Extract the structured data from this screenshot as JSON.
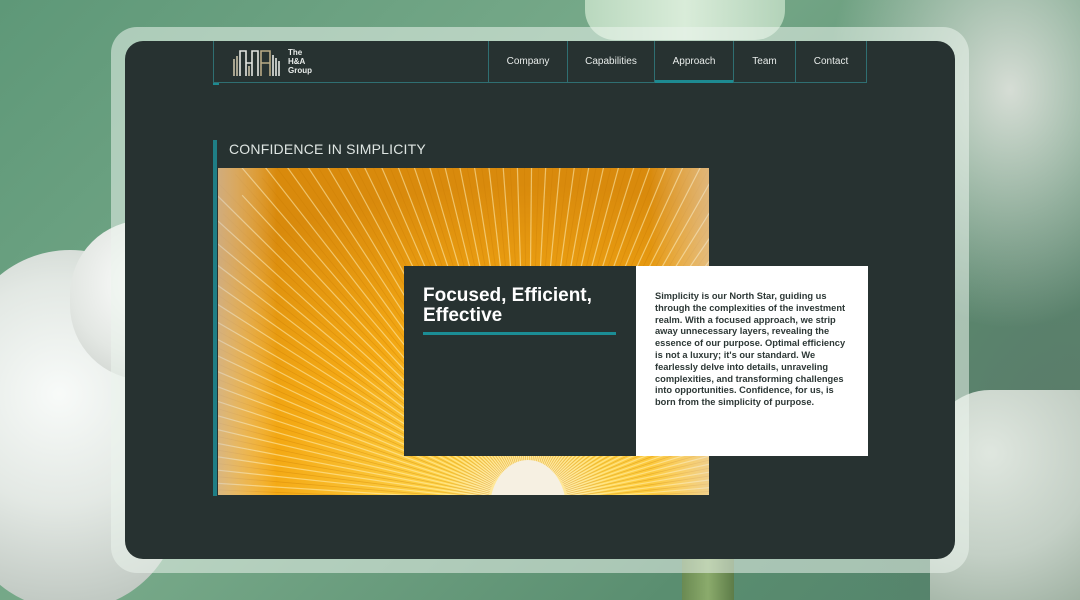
{
  "brand": {
    "logo_icon": "ha-monogram-logo",
    "name_lines": [
      "The",
      "H&A",
      "Group"
    ]
  },
  "nav": {
    "items": [
      {
        "label": "Company",
        "active": false
      },
      {
        "label": "Capabilities",
        "active": false
      },
      {
        "label": "Approach",
        "active": true
      },
      {
        "label": "Team",
        "active": false
      },
      {
        "label": "Contact",
        "active": false
      }
    ]
  },
  "section": {
    "title": "CONFIDENCE IN SIMPLICITY"
  },
  "card": {
    "heading": "Focused, Efficient, Effective",
    "body": "Simplicity is our North Star, guiding us through the complexities of the investment realm. With a focused approach, we strip away unnecessary layers, revealing the essence of our purpose. Optimal efficiency is not a luxury; it's our standard. We fearlessly delve into details, unraveling complexities, and transforming challenges into opportunities. Confidence, for us, is born from the simplicity of purpose."
  },
  "colors": {
    "window_bg": "#273231",
    "accent_teal": "#1d8a91",
    "text_light": "#e8ecea",
    "card_white": "#ffffff",
    "photo_gold": "#f0a81a"
  }
}
